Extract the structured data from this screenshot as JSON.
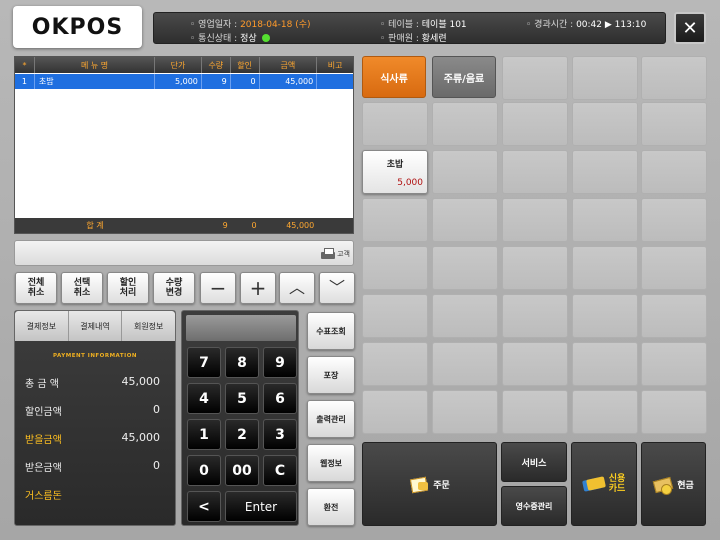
{
  "header": {
    "logo": "OKPOS",
    "business_date_label": "영업일자",
    "business_date": "2018-04-18 (수)",
    "comm_status_label": "통신상태",
    "comm_status": "정상",
    "table_label": "테이블",
    "table_value": "테이블 101",
    "cashier_label": "판매원",
    "cashier_value": "황세련",
    "elapsed_label": "경과시간",
    "elapsed_value": "00:42",
    "clock": "113:10",
    "close": "✕"
  },
  "order_table": {
    "columns": [
      "*",
      "메 뉴 명",
      "단가",
      "수량",
      "할인",
      "금액",
      "비고"
    ],
    "rows": [
      {
        "no": "1",
        "name": "초밥",
        "price": "5,000",
        "qty": "9",
        "discount": "0",
        "amount": "45,000",
        "note": ""
      }
    ],
    "total": {
      "label": "합    계",
      "qty": "9",
      "discount": "0",
      "amount": "45,000"
    }
  },
  "memo": {
    "print_label": "고객"
  },
  "edit_buttons": {
    "cancel_all": "전체\n취소",
    "cancel_selected": "선택\n취소",
    "discount": "할인\n처리",
    "change_qty": "수량\n변경",
    "minus": "−",
    "plus": "+",
    "up": "︿",
    "down": "﹀"
  },
  "payment": {
    "tabs": [
      "결제정보",
      "결제내역",
      "회원정보"
    ],
    "heading": "PAYMENT INFORMATION",
    "rows": [
      {
        "label": "총 금 액",
        "value": "45,000"
      },
      {
        "label": "할인금액",
        "value": "0"
      },
      {
        "label": "받을금액",
        "value": "45,000"
      },
      {
        "label": "받은금액",
        "value": "0"
      },
      {
        "label": "거스름돈",
        "value": ""
      }
    ]
  },
  "keypad": {
    "keys": [
      "7",
      "8",
      "9",
      "4",
      "5",
      "6",
      "1",
      "2",
      "3",
      "0",
      "00",
      "C"
    ],
    "back": "<",
    "enter": "Enter"
  },
  "side_buttons": [
    "수표조회",
    "포장",
    "출력관리",
    "웹정보",
    "환전"
  ],
  "categories": [
    {
      "label": "식사류",
      "active": true
    },
    {
      "label": "주류/음료",
      "active": false
    }
  ],
  "menu_items": [
    {
      "name": "초밥",
      "price": "5,000"
    }
  ],
  "actions": {
    "order": "주문",
    "service": "서비스",
    "receipt": "영수증관리",
    "credit_card": "신용\n카드",
    "cash": "현금"
  },
  "colors": {
    "accent_orange": "#e07a1c",
    "selected_row": "#1f6fe0",
    "status_green": "#55e030",
    "highlight_yellow": "#ffc020"
  }
}
